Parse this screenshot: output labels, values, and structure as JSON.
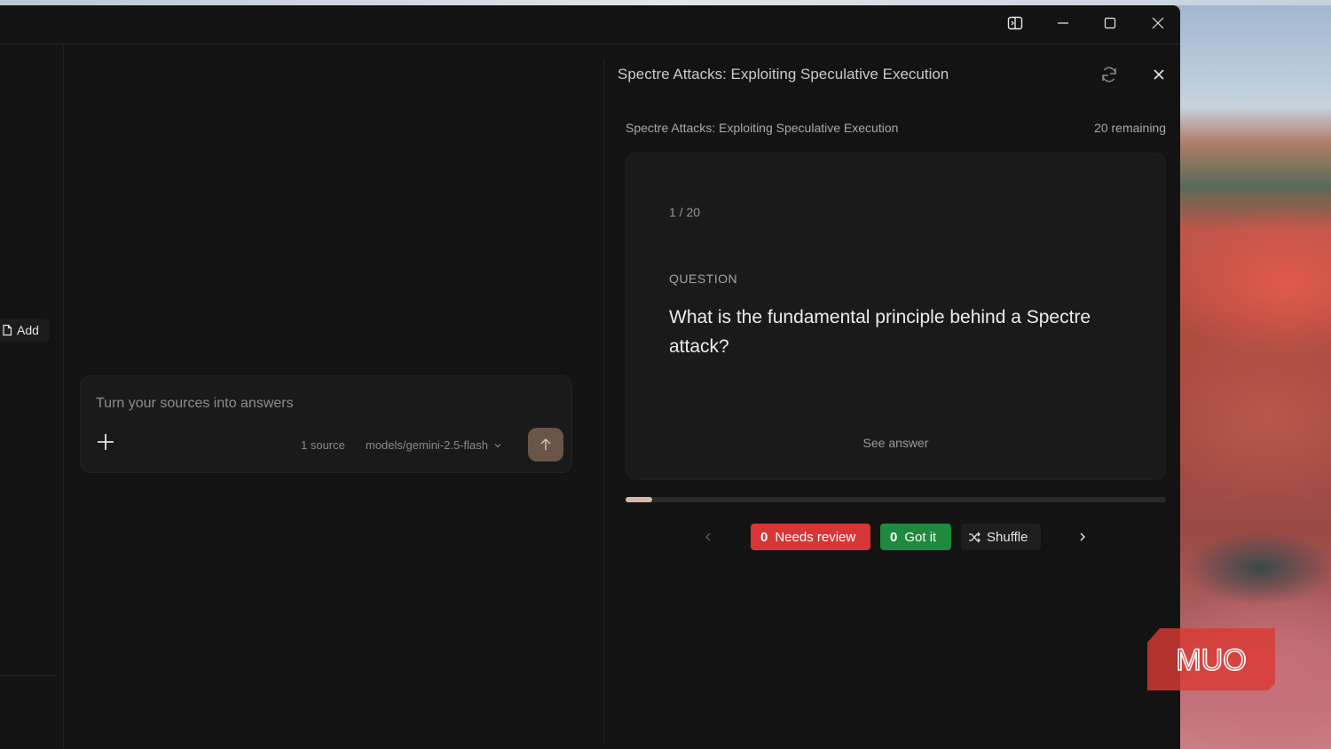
{
  "sidebar": {
    "add_label": "Add"
  },
  "composer": {
    "placeholder": "Turn your sources into answers",
    "source_count": "1 source",
    "model": "models/gemini-2.5-flash"
  },
  "studio": {
    "title": "Spectre Attacks: Exploiting Speculative Execution",
    "deck_name": "Spectre Attacks: Exploiting Speculative Execution",
    "remaining": "20 remaining",
    "card": {
      "counter": "1 / 20",
      "question_label": "QUESTION",
      "question": "What is the fundamental principle behind a Spectre attack?",
      "see_answer": "See answer"
    },
    "progress": {
      "current": 1,
      "total": 20
    },
    "controls": {
      "needs_review_count": "0",
      "needs_review_label": "Needs review",
      "got_it_count": "0",
      "got_it_label": "Got it",
      "shuffle_label": "Shuffle"
    }
  },
  "watermark": {
    "text": "MUO"
  },
  "colors": {
    "needs_review": "#d83636",
    "got_it": "#1f8a3e",
    "progress_fill": "#d8b9a7",
    "send_button": "#6b5549"
  }
}
